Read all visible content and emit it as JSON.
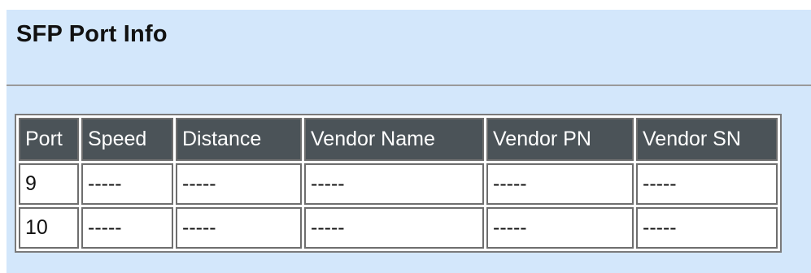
{
  "page": {
    "title": "SFP Port Info"
  },
  "table": {
    "headers": {
      "port": "Port",
      "speed": "Speed",
      "distance": "Distance",
      "vendor_name": "Vendor Name",
      "vendor_pn": "Vendor PN",
      "vendor_sn": "Vendor SN"
    },
    "rows": [
      {
        "port": "9",
        "speed": "-----",
        "distance": "-----",
        "vendor_name": "-----",
        "vendor_pn": "-----",
        "vendor_sn": "-----"
      },
      {
        "port": "10",
        "speed": "-----",
        "distance": "-----",
        "vendor_name": "-----",
        "vendor_pn": "-----",
        "vendor_sn": "-----"
      }
    ]
  },
  "colors": {
    "panel_background": "#d3e7fb",
    "header_background": "#4b5358",
    "header_text": "#ffffff",
    "cell_background": "#ffffff",
    "border": "#6e6e6e"
  }
}
